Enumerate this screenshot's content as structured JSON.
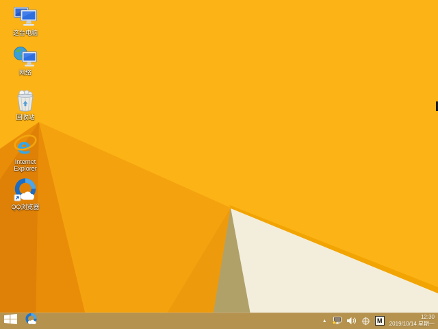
{
  "wallpaper": {
    "colors": {
      "base": "#fcb316",
      "mid": "#f4a30f",
      "mid2": "#ee9a0d",
      "dark": "#e98d08",
      "darker": "#df8106",
      "khaki": "#b0a169",
      "cream": "#f3eedb",
      "gold_line": "#f2a403",
      "edge_artifact": "#1d1a14"
    }
  },
  "desktop_icons": [
    {
      "id": "this-pc",
      "label": "这台电脑"
    },
    {
      "id": "network",
      "label": "网络"
    },
    {
      "id": "recycle-bin",
      "label": "回收站"
    },
    {
      "id": "internet-explorer",
      "label": "Internet Explorer"
    },
    {
      "id": "qq-browser",
      "label": "QQ浏览器"
    }
  ],
  "taskbar": {
    "color": "#b5924e",
    "tray": {
      "time": "12:30",
      "date": "2019/10/14 星期一",
      "ime": "M"
    }
  }
}
